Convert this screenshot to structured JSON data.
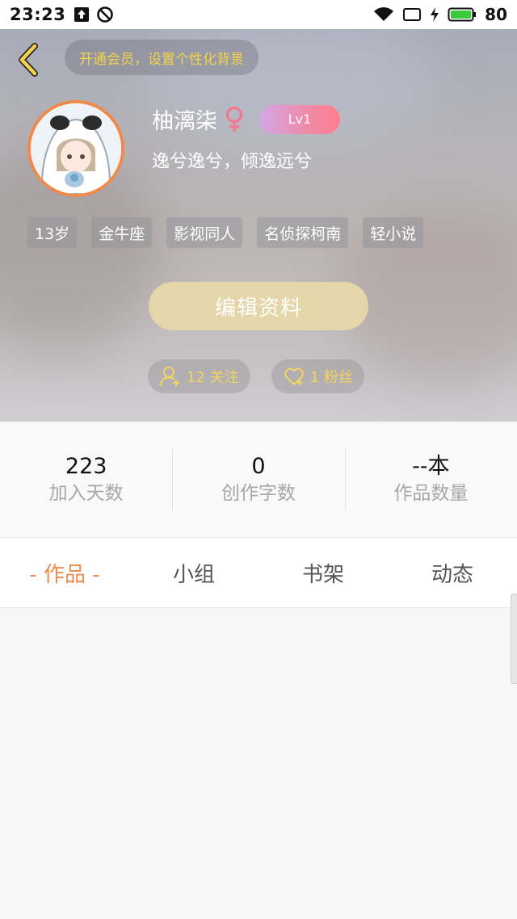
{
  "status_bar": {
    "time": "23:23",
    "battery": "80",
    "icons": [
      "upload-icon",
      "dnd-icon",
      "wifi-icon",
      "screen-icon",
      "charging-icon",
      "battery-icon"
    ]
  },
  "header": {
    "vip_prompt": "开通会员，设置个性化背景",
    "user_name": "柚漓柒",
    "gender_icon": "female-icon",
    "level": "Lv1",
    "signature": "逸兮逸兮，倾逸远兮",
    "tags": [
      "13岁",
      "金牛座",
      "影视同人",
      "名侦探柯南",
      "轻小说"
    ],
    "edit_button": "编辑资料",
    "following": "12 关注",
    "followers": "1 粉丝"
  },
  "stats": [
    {
      "value": "223",
      "label": "加入天数"
    },
    {
      "value": "0",
      "label": "创作字数"
    },
    {
      "value": "--本",
      "label": "作品数量"
    }
  ],
  "tabs": [
    "- 作品 -",
    "小组",
    "书架",
    "动态"
  ],
  "colors": {
    "accent": "#f08a4b",
    "vip_text": "#f3d34a",
    "edit_button": "#e4d6a9",
    "gender": "#f07a94"
  }
}
